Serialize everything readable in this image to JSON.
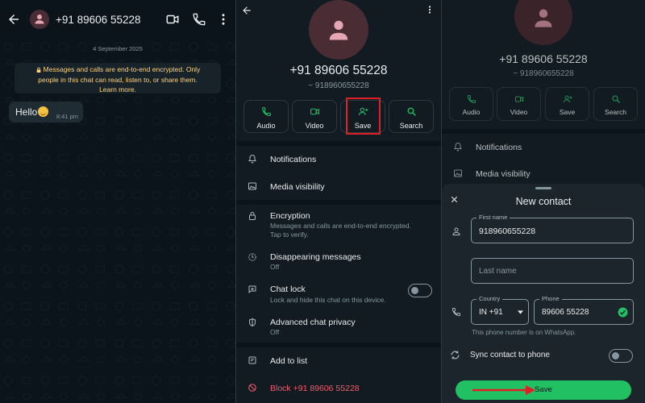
{
  "colors": {
    "accent": "#21c063",
    "bg_dark": "#0b141a",
    "panel": "#111b21",
    "danger": "#f15c6d",
    "encryption_note": "#ffd279",
    "highlight": "#e11d26"
  },
  "chat": {
    "contact": "+91 89606 55228",
    "date_chip": "4 September 2025",
    "encryption_lines": [
      "Messages and calls are end-to-end encrypted. Only",
      "people in this chat can read, listen to, or share them.",
      "Learn more."
    ],
    "message": {
      "text": "Hello",
      "emoji": "smiling-face-emoji",
      "time": "8:41 pm"
    },
    "header_icons": [
      "back-arrow-icon",
      "video-call-icon",
      "voice-call-icon",
      "more-vert-icon"
    ]
  },
  "info": {
    "number": "+91 89606 55228",
    "subtitle": "~ 918960655228",
    "actions": [
      {
        "label": "Audio",
        "icon": "phone-icon"
      },
      {
        "label": "Video",
        "icon": "video-icon"
      },
      {
        "label": "Save",
        "icon": "add-person-icon"
      },
      {
        "label": "Search",
        "icon": "search-icon"
      }
    ],
    "notifications": "Notifications",
    "media_visibility": "Media visibility",
    "encryption": {
      "title": "Encryption",
      "desc": "Messages and calls are end-to-end encrypted.",
      "desc2": "Tap to verify."
    },
    "disappearing": {
      "title": "Disappearing messages",
      "value": "Off"
    },
    "chat_lock": {
      "title": "Chat lock",
      "desc": "Lock and hide this chat on this device.",
      "enabled": false
    },
    "advanced_privacy": {
      "title": "Advanced chat privacy",
      "value": "Off"
    },
    "add_to_list": "Add to list",
    "block": "Block +91 89606 55228"
  },
  "new_contact": {
    "bg_number": "+91 89606 55228",
    "bg_subtitle": "~ 918960655228",
    "bg_actions": [
      "Audio",
      "Video",
      "Save",
      "Search"
    ],
    "bg_notifications": "Notifications",
    "bg_media": "Media visibility",
    "title": "New contact",
    "first_name_label": "First name",
    "first_name_value": "918960655228",
    "last_name_placeholder": "Last name",
    "country_label": "Country",
    "country_value": "IN +91",
    "phone_label": "Phone",
    "phone_value": "89606 55228",
    "whatsapp_note": "This phone number is on WhatsApp.",
    "sync_label": "Sync contact to phone",
    "sync_enabled": false,
    "save_label": "Save"
  }
}
